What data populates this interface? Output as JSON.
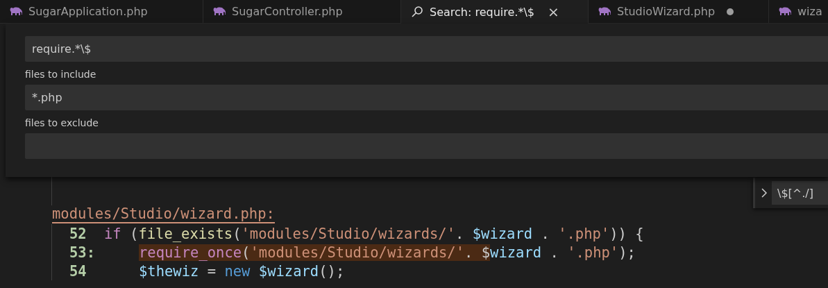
{
  "tabs": [
    {
      "kind": "file",
      "label": "SugarApplication.php",
      "selected": false,
      "modified": false
    },
    {
      "kind": "file",
      "label": "SugarController.php",
      "selected": false,
      "modified": false
    },
    {
      "kind": "search",
      "label": "Search: require.*\\$",
      "selected": true,
      "modified": false,
      "close": "×"
    },
    {
      "kind": "file",
      "label": "StudioWizard.php",
      "selected": false,
      "modified": true
    },
    {
      "kind": "file",
      "label": "wiza",
      "selected": false,
      "modified": false
    }
  ],
  "search_panel": {
    "query": "require.*\\$",
    "include_label": "files to include",
    "include_value": "*.php",
    "exclude_label": "files to exclude"
  },
  "results": [
    {
      "kind": "blank"
    },
    {
      "kind": "blank"
    },
    {
      "kind": "file",
      "path": "modules/Studio/wizard.php:"
    },
    {
      "kind": "line",
      "number": "52",
      "indented": false,
      "tokens": [
        {
          "kind": "control",
          "text": "if",
          "match": false
        },
        {
          "kind": "plain",
          "text": " (",
          "match": false
        },
        {
          "kind": "func",
          "text": "file_exists",
          "match": false
        },
        {
          "kind": "plain",
          "text": "(",
          "match": false
        },
        {
          "kind": "string",
          "text": "'modules/Studio/wizards/'",
          "match": false
        },
        {
          "kind": "plain",
          "text": ". ",
          "match": false
        },
        {
          "kind": "var",
          "text": "$wizard",
          "match": false
        },
        {
          "kind": "plain",
          "text": " . ",
          "match": false
        },
        {
          "kind": "string",
          "text": "'.php'",
          "match": false
        },
        {
          "kind": "plain",
          "text": ")) {",
          "match": false
        }
      ]
    },
    {
      "kind": "line",
      "number": "53:",
      "indented": true,
      "tokens": [
        {
          "kind": "control",
          "text": "require_once",
          "match": true
        },
        {
          "kind": "plain",
          "text": "(",
          "match": true
        },
        {
          "kind": "string",
          "text": "'modules/Studio/wizards/'",
          "match": true
        },
        {
          "kind": "plain",
          "text": ". $",
          "match": true
        },
        {
          "kind": "var",
          "text": "wizard",
          "match": false
        },
        {
          "kind": "plain",
          "text": " . ",
          "match": false
        },
        {
          "kind": "string",
          "text": "'.php'",
          "match": false
        },
        {
          "kind": "plain",
          "text": ");",
          "match": false
        }
      ]
    },
    {
      "kind": "line",
      "number": "54",
      "indented": true,
      "tokens": [
        {
          "kind": "var",
          "text": "$thewiz",
          "match": false
        },
        {
          "kind": "plain",
          "text": " = ",
          "match": false
        },
        {
          "kind": "keyword",
          "text": "new",
          "match": false
        },
        {
          "kind": "var",
          "text": " $wizard",
          "match": false
        },
        {
          "kind": "plain",
          "text": "();",
          "match": false
        }
      ]
    }
  ],
  "replace_widget": {
    "value": "\\$[^./]"
  }
}
